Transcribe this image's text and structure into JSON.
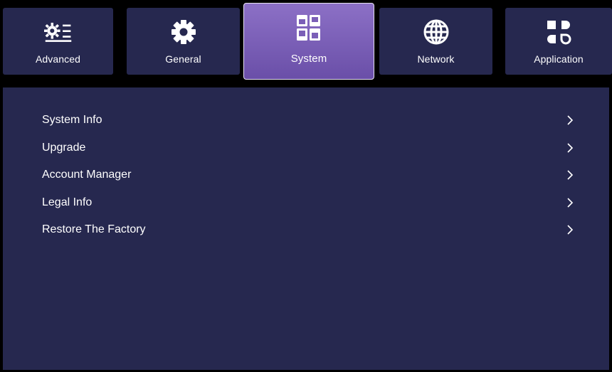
{
  "tabs": [
    {
      "label": "Advanced",
      "icon": "gear-list-icon",
      "active": false
    },
    {
      "label": "General",
      "icon": "gear-icon",
      "active": false
    },
    {
      "label": "System",
      "icon": "windows-icon",
      "active": true
    },
    {
      "label": "Network",
      "icon": "globe-icon",
      "active": false
    },
    {
      "label": "Application",
      "icon": "apps-icon",
      "active": false
    }
  ],
  "menu": {
    "items": [
      {
        "label": "System Info"
      },
      {
        "label": "Upgrade"
      },
      {
        "label": "Account Manager"
      },
      {
        "label": "Legal Info"
      },
      {
        "label": "Restore The Factory"
      }
    ]
  },
  "colors": {
    "background": "#000000",
    "panel": "#26284f",
    "tab": "#26284f",
    "active_tab_top": "#8c70c6",
    "active_tab_bottom": "#6a4fa8",
    "text": "#ffffff"
  }
}
